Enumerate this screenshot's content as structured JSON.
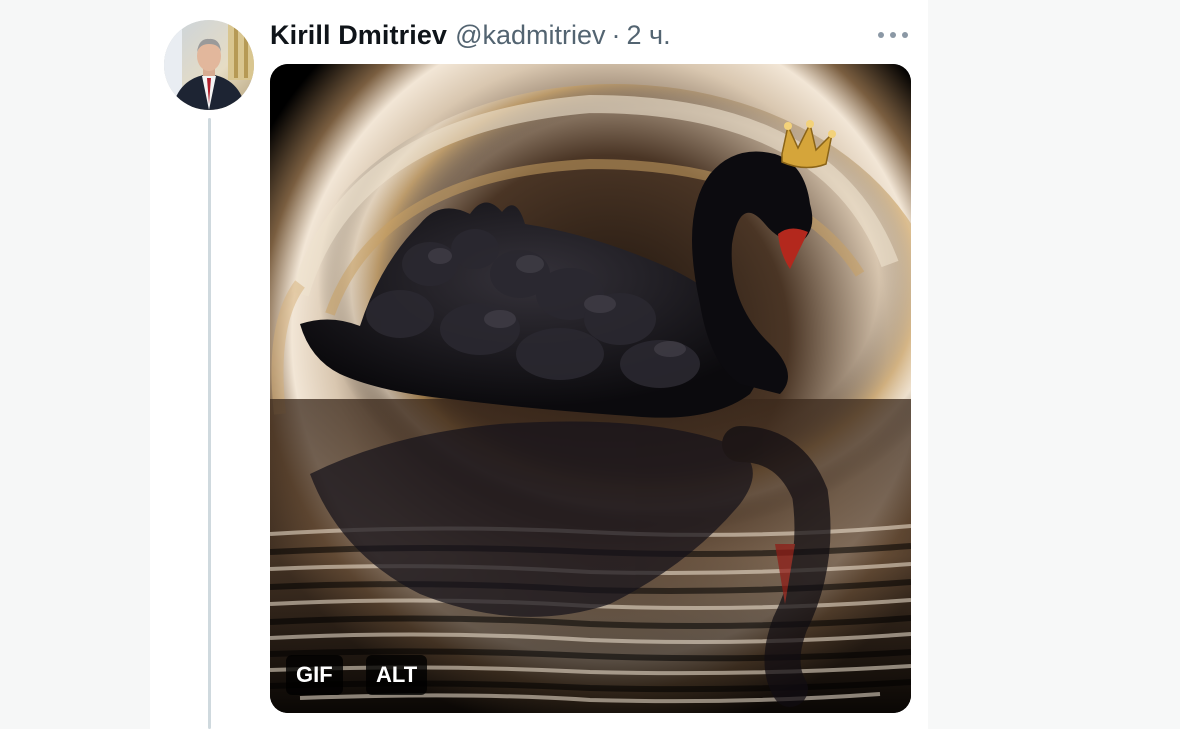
{
  "tweet": {
    "author_name": "Kirill Dmitriev",
    "author_handle": "@kadmitriev",
    "separator": "·",
    "time": "2 ч.",
    "media": {
      "type": "gif",
      "description": "black swan with golden crown",
      "gif_badge": "GIF",
      "alt_badge": "ALT"
    }
  },
  "colors": {
    "name": "#0f1419",
    "secondary_text": "#536471",
    "thread_line": "#cfd9de",
    "badge_background": "#000000",
    "page_background": "#f7f8f8"
  },
  "icons": {
    "more": "more-horizontal-icon"
  }
}
